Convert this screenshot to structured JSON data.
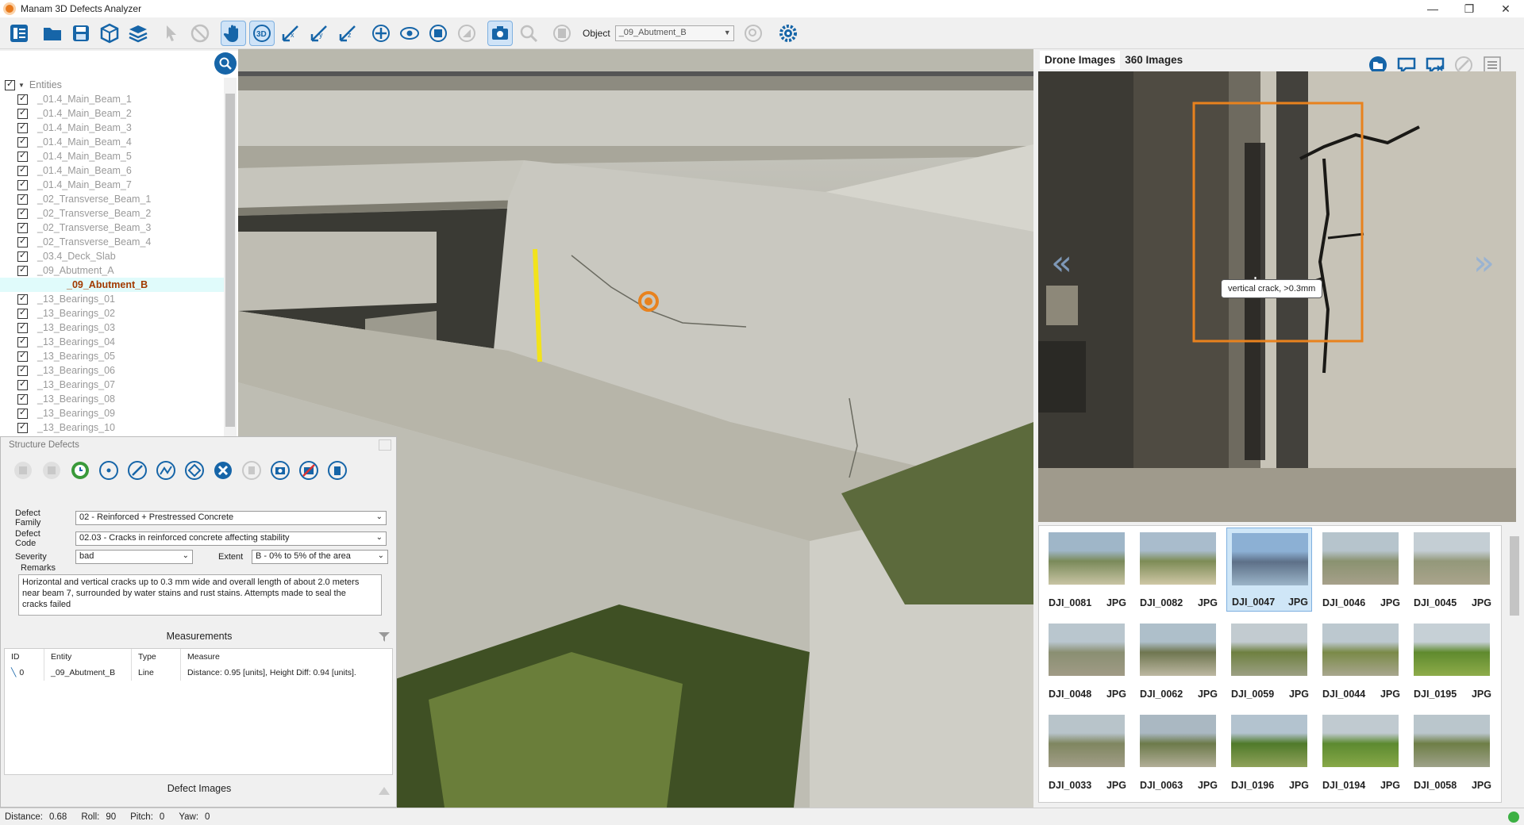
{
  "window": {
    "title": "Manam 3D Defects Analyzer"
  },
  "toolbar": {
    "object_label": "Object",
    "object_value": "_09_Abutment_B"
  },
  "tree": {
    "root": "Entities",
    "items": [
      "_01.4_Main_Beam_1",
      "_01.4_Main_Beam_2",
      "_01.4_Main_Beam_3",
      "_01.4_Main_Beam_4",
      "_01.4_Main_Beam_5",
      "_01.4_Main_Beam_6",
      "_01.4_Main_Beam_7",
      "_02_Transverse_Beam_1",
      "_02_Transverse_Beam_2",
      "_02_Transverse_Beam_3",
      "_02_Transverse_Beam_4",
      "_03.4_Deck_Slab",
      "_09_Abutment_A",
      "_09_Abutment_B",
      "_13_Bearings_01",
      "_13_Bearings_02",
      "_13_Bearings_03",
      "_13_Bearings_04",
      "_13_Bearings_05",
      "_13_Bearings_06",
      "_13_Bearings_07",
      "_13_Bearings_08",
      "_13_Bearings_09",
      "_13_Bearings_10"
    ],
    "selected": "_09_Abutment_B"
  },
  "defects": {
    "title": "Structure Defects",
    "family_label": "Defect Family",
    "family_value": "02 - Reinforced + Prestressed Concrete",
    "code_label": "Defect Code",
    "code_value": "02.03 - Cracks in reinforced concrete affecting stability",
    "severity_label": "Severity",
    "severity_value": "bad",
    "extent_label": "Extent",
    "extent_value": "B - 0% to 5% of the area",
    "remarks_label": "Remarks",
    "remarks_text": "Horizontal and vertical cracks up to 0.3 mm wide and overall length of about 2.0 meters near beam 7, surrounded by water stains and rust stains. Attempts made to seal the cracks failed",
    "measurements_title": "Measurements",
    "table_headers": [
      "ID",
      "Entity",
      "Type",
      "Measure"
    ],
    "table_rows": [
      {
        "id": "0",
        "entity": "_09_Abutment_B",
        "type": "Line",
        "measure": "Distance: 0.95 [units], Height Diff: 0.94 [units]."
      }
    ],
    "defect_images_title": "Defect Images"
  },
  "right_panel": {
    "tabs": [
      "Drone Images",
      "360 Images"
    ],
    "annotation_label": "vertical crack, >0.3mm",
    "thumbnails": [
      {
        "name": "DJI_0081",
        "ext": "JPG"
      },
      {
        "name": "DJI_0082",
        "ext": "JPG"
      },
      {
        "name": "DJI_0047",
        "ext": "JPG"
      },
      {
        "name": "DJI_0046",
        "ext": "JPG"
      },
      {
        "name": "DJI_0045",
        "ext": "JPG"
      },
      {
        "name": "DJI_0048",
        "ext": "JPG"
      },
      {
        "name": "DJI_0062",
        "ext": "JPG"
      },
      {
        "name": "DJI_0059",
        "ext": "JPG"
      },
      {
        "name": "DJI_0044",
        "ext": "JPG"
      },
      {
        "name": "DJI_0195",
        "ext": "JPG"
      },
      {
        "name": "DJI_0033",
        "ext": "JPG"
      },
      {
        "name": "DJI_0063",
        "ext": "JPG"
      },
      {
        "name": "DJI_0196",
        "ext": "JPG"
      },
      {
        "name": "DJI_0194",
        "ext": "JPG"
      },
      {
        "name": "DJI_0058",
        "ext": "JPG"
      }
    ],
    "selected_thumbnail": "DJI_0047"
  },
  "status": {
    "distance_label": "Distance:",
    "distance_value": "0.68",
    "roll_label": "Roll:",
    "roll_value": "90",
    "pitch_label": "Pitch:",
    "pitch_value": "0",
    "yaw_label": "Yaw:",
    "yaw_value": "0"
  },
  "colors": {
    "accent": "#1665a8",
    "selection_box": "#e8821e",
    "measure_line": "#f2e31b"
  }
}
